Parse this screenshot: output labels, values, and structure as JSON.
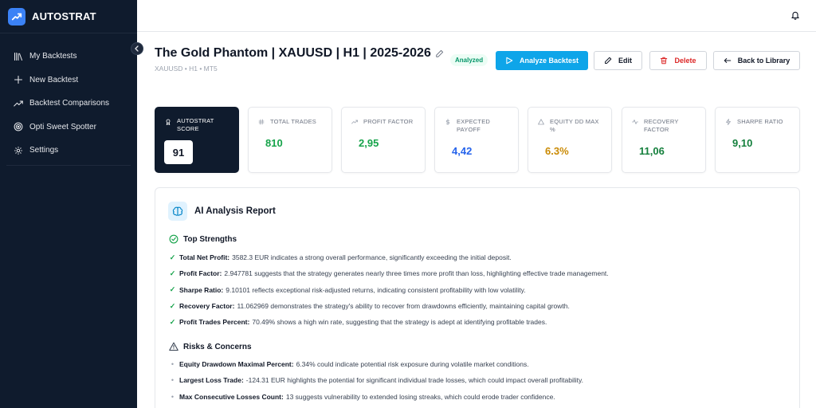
{
  "app": {
    "name": "AUTOSTRAT"
  },
  "sidebar": {
    "items": [
      {
        "label": "My Backtests",
        "icon": "library-icon"
      },
      {
        "label": "New Backtest",
        "icon": "plus-icon"
      },
      {
        "label": "Backtest Comparisons",
        "icon": "trend-icon"
      },
      {
        "label": "Opti Sweet Spotter",
        "icon": "target-icon"
      },
      {
        "label": "Settings",
        "icon": "gear-icon"
      }
    ]
  },
  "header": {
    "title": "The Gold Phantom | XAUUSD | H1 | 2025-2026",
    "subtitle": "XAUUSD • H1 • MT5",
    "status_badge": "Analyzed"
  },
  "actions": {
    "analyze": "Analyze Backtest",
    "edit": "Edit",
    "delete": "Delete",
    "back": "Back to Library"
  },
  "metrics": {
    "score": {
      "label": "AUTOSTRAT SCORE",
      "value": "91"
    },
    "total_trades": {
      "label": "TOTAL TRADES",
      "value": "810",
      "color": "#16a34a"
    },
    "profit_factor": {
      "label": "PROFIT FACTOR",
      "value": "2,95",
      "color": "#16a34a"
    },
    "expected_payoff": {
      "label": "EXPECTED PAYOFF",
      "value": "4,42",
      "color": "#2563eb"
    },
    "equity_dd_max": {
      "label": "EQUITY DD MAX %",
      "value": "6.3%",
      "color": "#ca8a04"
    },
    "recovery_factor": {
      "label": "RECOVERY FACTOR",
      "value": "11,06",
      "color": "#15803d"
    },
    "sharpe_ratio": {
      "label": "SHARPE RATIO",
      "value": "9,10",
      "color": "#15803d"
    }
  },
  "report": {
    "title": "AI Analysis Report",
    "strengths": {
      "heading": "Top Strengths",
      "items": [
        {
          "key": "Total Net Profit:",
          "text": "3582.3 EUR indicates a strong overall performance, significantly exceeding the initial deposit."
        },
        {
          "key": "Profit Factor:",
          "text": "2.947781 suggests that the strategy generates nearly three times more profit than loss, highlighting effective trade management."
        },
        {
          "key": "Sharpe Ratio:",
          "text": "9.10101 reflects exceptional risk-adjusted returns, indicating consistent profitability with low volatility."
        },
        {
          "key": "Recovery Factor:",
          "text": "11.062969 demonstrates the strategy's ability to recover from drawdowns efficiently, maintaining capital growth."
        },
        {
          "key": "Profit Trades Percent:",
          "text": "70.49% shows a high win rate, suggesting that the strategy is adept at identifying profitable trades."
        }
      ]
    },
    "risks": {
      "heading": "Risks & Concerns",
      "items": [
        {
          "key": "Equity Drawdown Maximal Percent:",
          "text": "6.34% could indicate potential risk exposure during volatile market conditions."
        },
        {
          "key": "Largest Loss Trade:",
          "text": "-124.31 EUR highlights the potential for significant individual trade losses, which could impact overall profitability."
        },
        {
          "key": "Max Consecutive Losses Count:",
          "text": "13 suggests vulnerability to extended losing streaks, which could erode trader confidence."
        }
      ]
    }
  }
}
